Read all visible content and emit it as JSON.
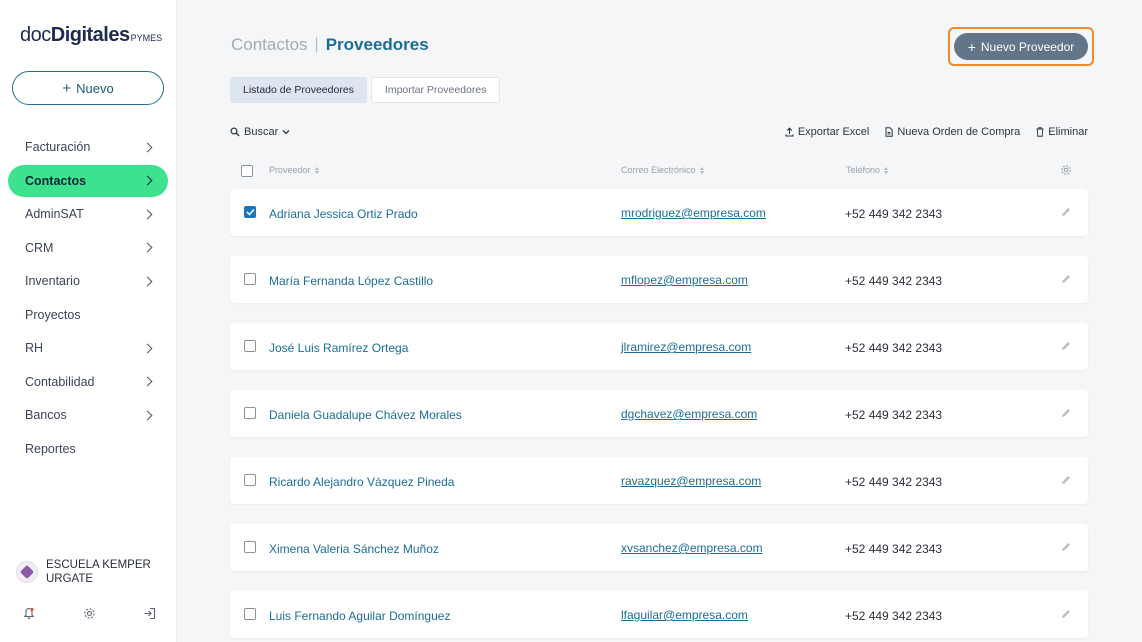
{
  "brand": {
    "part1": "doc",
    "part2": "Digitales",
    "part3": "PYMES"
  },
  "sidebar": {
    "new_button": "Nuevo",
    "items": [
      {
        "label": "Facturación",
        "has_chevron": true,
        "active": false
      },
      {
        "label": "Contactos",
        "has_chevron": true,
        "active": true
      },
      {
        "label": "AdminSAT",
        "has_chevron": true,
        "active": false
      },
      {
        "label": "CRM",
        "has_chevron": true,
        "active": false
      },
      {
        "label": "Inventario",
        "has_chevron": true,
        "active": false
      },
      {
        "label": "Proyectos",
        "has_chevron": false,
        "active": false
      },
      {
        "label": "RH",
        "has_chevron": true,
        "active": false
      },
      {
        "label": "Contabilidad",
        "has_chevron": true,
        "active": false
      },
      {
        "label": "Bancos",
        "has_chevron": true,
        "active": false
      },
      {
        "label": "Reportes",
        "has_chevron": false,
        "active": false
      }
    ],
    "org_name": "ESCUELA KEMPER URGATE",
    "bottom_icons": [
      "bell-icon",
      "gear-icon",
      "logout-icon"
    ]
  },
  "header": {
    "breadcrumb_parent": "Contactos",
    "breadcrumb_separator": "|",
    "breadcrumb_current": "Proveedores",
    "primary_button": "Nuevo Proveedor"
  },
  "tabs": [
    {
      "label": "Listado de Proveedores",
      "active": true
    },
    {
      "label": "Importar Proveedores",
      "active": false
    }
  ],
  "toolbar": {
    "search": "Buscar",
    "export_excel": "Exportar Excel",
    "new_order": "Nueva Orden de Compra",
    "delete": "Eliminar"
  },
  "table": {
    "columns": [
      "Proveedor",
      "Correo Electrónico",
      "Teléfono"
    ],
    "rows": [
      {
        "name": "Adriana Jessica Ortiz Prado",
        "email": "mrodriguez@empresa.com",
        "phone": "+52 449 342 2343",
        "checked": true
      },
      {
        "name": "María Fernanda López Castillo",
        "email": "mflopez@empresa.com",
        "phone": "+52 449 342 2343",
        "checked": false
      },
      {
        "name": "José Luis Ramírez Ortega",
        "email": "jlramirez@empresa.com",
        "phone": "+52 449 342 2343",
        "checked": false
      },
      {
        "name": "Daniela Guadalupe Chávez Morales",
        "email": "dgchavez@empresa.com",
        "phone": "+52 449 342 2343",
        "checked": false
      },
      {
        "name": "Ricardo Alejandro Vázquez Pineda",
        "email": "ravazquez@empresa.com",
        "phone": "+52 449 342 2343",
        "checked": false
      },
      {
        "name": "Ximena Valeria Sánchez Muñoz",
        "email": "xvsanchez@empresa.com",
        "phone": "+52 449 342 2343",
        "checked": false
      },
      {
        "name": "Luis Fernando Aguilar Domínguez",
        "email": "lfaguilar@empresa.com",
        "phone": "+52 449 342 2343",
        "checked": false
      }
    ]
  },
  "colors": {
    "accent": "#1c6d98",
    "active_nav": "#3ce28e",
    "primary_button": "#637589",
    "highlight_outline": "#f08a2e",
    "checkbox_checked": "#1d74b8"
  }
}
